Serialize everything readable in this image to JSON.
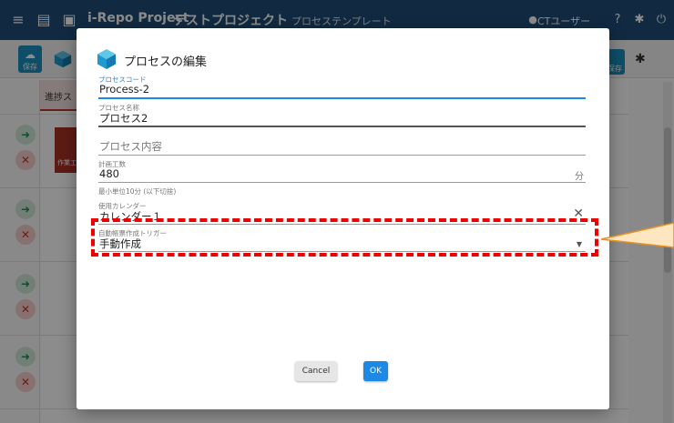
{
  "app": {
    "name": "i-Repo Project",
    "project_name": "テストプロジェクト",
    "template_link": "プロセステンプレート",
    "user_name": "CTユーザー"
  },
  "toolbar": {
    "save_label": "保存",
    "save2_label": "保存"
  },
  "background": {
    "progress_tab_label": "進捗ス",
    "task_card_label": "作業工"
  },
  "dialog": {
    "title": "プロセスの編集",
    "fields": {
      "process_code": {
        "label": "プロセスコード",
        "value": "Process-2"
      },
      "process_name": {
        "label": "プロセス名称",
        "value": "プロセス2"
      },
      "process_content": {
        "placeholder": "プロセス内容"
      },
      "planned_hours": {
        "label": "計画工数",
        "value": "480",
        "unit": "分",
        "hint": "最小単位10分 (以下切捨)"
      },
      "calendar": {
        "label": "使用カレンダー",
        "value": "カレンダー１"
      },
      "auto_trigger": {
        "label": "自動帳票作成トリガー",
        "value": "手動作成"
      }
    },
    "cancel_label": "Cancel",
    "ok_label": "OK"
  },
  "colors": {
    "header_bg": "#1f4e79",
    "primary": "#1e88e5",
    "highlight": "#ee0000",
    "callout": "#e89020"
  }
}
